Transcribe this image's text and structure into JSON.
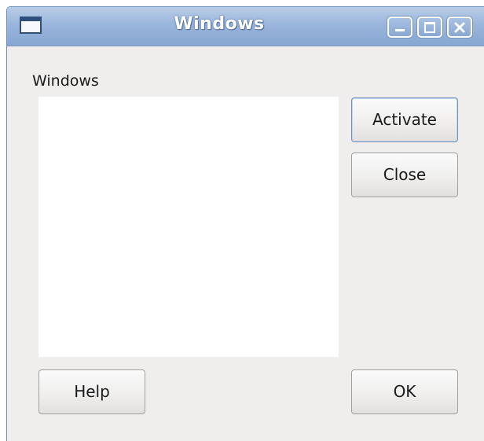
{
  "window": {
    "title": "Windows",
    "controls": [
      "minimize",
      "maximize",
      "close"
    ]
  },
  "dialog": {
    "list_label": "Windows",
    "windows_list": [],
    "buttons": {
      "activate": "Activate",
      "close": "Close",
      "help": "Help",
      "ok": "OK"
    }
  },
  "colors": {
    "titlebar": "#9ab5dc",
    "background": "#efeeed",
    "focus_border": "#6f8fb8"
  }
}
